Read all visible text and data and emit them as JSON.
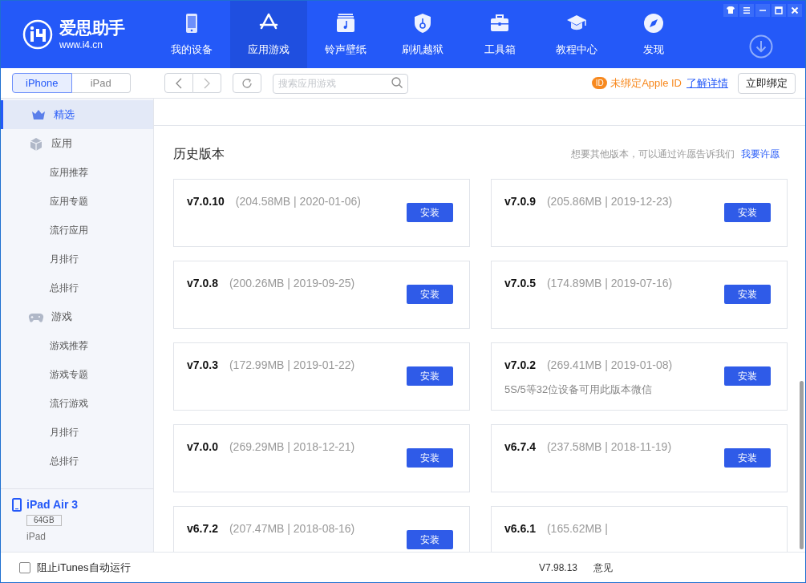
{
  "logo": {
    "name": "爱思助手",
    "url": "www.i4.cn"
  },
  "nav": [
    {
      "label": "我的设备",
      "kind": "phone",
      "selected": false
    },
    {
      "label": "应用游戏",
      "kind": "appstore",
      "selected": true
    },
    {
      "label": "铃声壁纸",
      "kind": "music",
      "selected": false
    },
    {
      "label": "刷机越狱",
      "kind": "shield",
      "selected": false
    },
    {
      "label": "工具箱",
      "kind": "toolbox",
      "selected": false
    },
    {
      "label": "教程中心",
      "kind": "cap",
      "selected": false
    },
    {
      "label": "发现",
      "kind": "compass",
      "selected": false
    }
  ],
  "device_tabs": [
    {
      "label": "iPhone",
      "selected": true
    },
    {
      "label": "iPad",
      "selected": false
    }
  ],
  "search": {
    "placeholder": "搜索应用游戏"
  },
  "apple_id": {
    "badge": "ID",
    "status": "未绑定Apple ID",
    "link": "了解详情",
    "button": "立即绑定"
  },
  "sidebar": {
    "items": [
      {
        "label": "精选",
        "kind": "crown",
        "selected": true
      },
      {
        "label": "应用",
        "kind": "cube",
        "selected": false,
        "children": [
          {
            "label": "应用推荐",
            "selected": false
          },
          {
            "label": "应用专题",
            "selected": false
          },
          {
            "label": "流行应用",
            "selected": false
          },
          {
            "label": "月排行",
            "selected": false
          },
          {
            "label": "总排行",
            "selected": false
          }
        ]
      },
      {
        "label": "游戏",
        "kind": "gamepad",
        "selected": false,
        "children": [
          {
            "label": "游戏推荐",
            "selected": false
          },
          {
            "label": "游戏专题",
            "selected": false
          },
          {
            "label": "流行游戏",
            "selected": false
          },
          {
            "label": "月排行",
            "selected": false
          },
          {
            "label": "总排行",
            "selected": false
          }
        ]
      }
    ]
  },
  "device": {
    "name": "iPad Air 3",
    "capacity": "64GB",
    "type": "iPad"
  },
  "history": {
    "title": "历史版本",
    "hint": "想要其他版本，可以通过许愿告诉我们",
    "link": "我要许愿",
    "versions": [
      {
        "version": "v7.0.10",
        "info": "(204.58MB | 2020-01-06)",
        "button": "安装"
      },
      {
        "version": "v7.0.9",
        "info": "(205.86MB | 2019-12-23)",
        "button": "安装"
      },
      {
        "version": "v7.0.8",
        "info": "(200.26MB | 2019-09-25)",
        "button": "安装"
      },
      {
        "version": "v7.0.5",
        "info": "(174.89MB | 2019-07-16)",
        "button": "安装"
      },
      {
        "version": "v7.0.3",
        "info": "(172.99MB | 2019-01-22)",
        "button": "安装"
      },
      {
        "version": "v7.0.2",
        "info": "(269.41MB | 2019-01-08)",
        "note": "5S/5等32位设备可用此版本微信",
        "button": "安装"
      },
      {
        "version": "v7.0.0",
        "info": "(269.29MB | 2018-12-21)",
        "button": "安装"
      },
      {
        "version": "v6.7.4",
        "info": "(237.58MB | 2018-11-19)",
        "button": "安装"
      },
      {
        "version": "v6.7.2",
        "info": "(207.47MB | 2018-08-16)",
        "button": "安装"
      },
      {
        "version": "v6.6.1",
        "info": "(165.62MB |"
      }
    ]
  },
  "footer": {
    "itunes_block": {
      "label": "阻止iTunes自动运行",
      "checked": false
    },
    "version": "V7.98.13",
    "feedback": "意见"
  }
}
